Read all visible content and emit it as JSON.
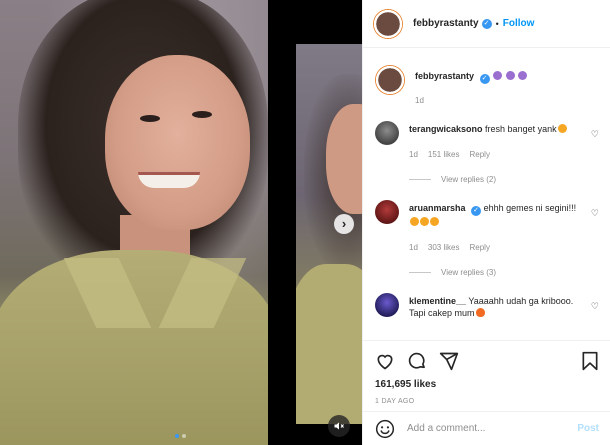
{
  "post": {
    "username": "febbyrastanty",
    "follow_label": "Follow",
    "more_icon": "more-horizontal-icon",
    "caption": {
      "username": "febbyrastanty",
      "emoji": [
        "woman-emoji",
        "woman-emoji",
        "woman-emoji"
      ],
      "time": "1d"
    },
    "comments": [
      {
        "username": "terangwicaksono",
        "text": "fresh banget yank",
        "emoji": [
          "smiling-face-with-heart-eyes"
        ],
        "time": "1d",
        "likes": "151 likes",
        "reply": "Reply",
        "view_replies": "View replies (2)"
      },
      {
        "username": "aruanmarsha",
        "verified": true,
        "text": "ehhh gemes ni segini!!!",
        "emoji": [
          "smiling-face-with-heart-eyes",
          "smiling-face-with-heart-eyes",
          "smiling-face-with-heart-eyes"
        ],
        "time": "1d",
        "likes": "303 likes",
        "reply": "Reply",
        "view_replies": "View replies (3)"
      },
      {
        "username": "klementine__",
        "text": "Yaaaahh udah ga kribooo. Tapi cakep mum",
        "emoji": [
          "fire"
        ]
      }
    ],
    "likes": "161,695 likes",
    "date": "1 DAY AGO",
    "add_comment_placeholder": "Add a comment...",
    "post_label": "Post"
  },
  "carousel": {
    "current": 1,
    "total": 2
  },
  "colors": {
    "accent": "#0095f6",
    "verified": "#3897f0",
    "muted": "#8e8e8e"
  }
}
